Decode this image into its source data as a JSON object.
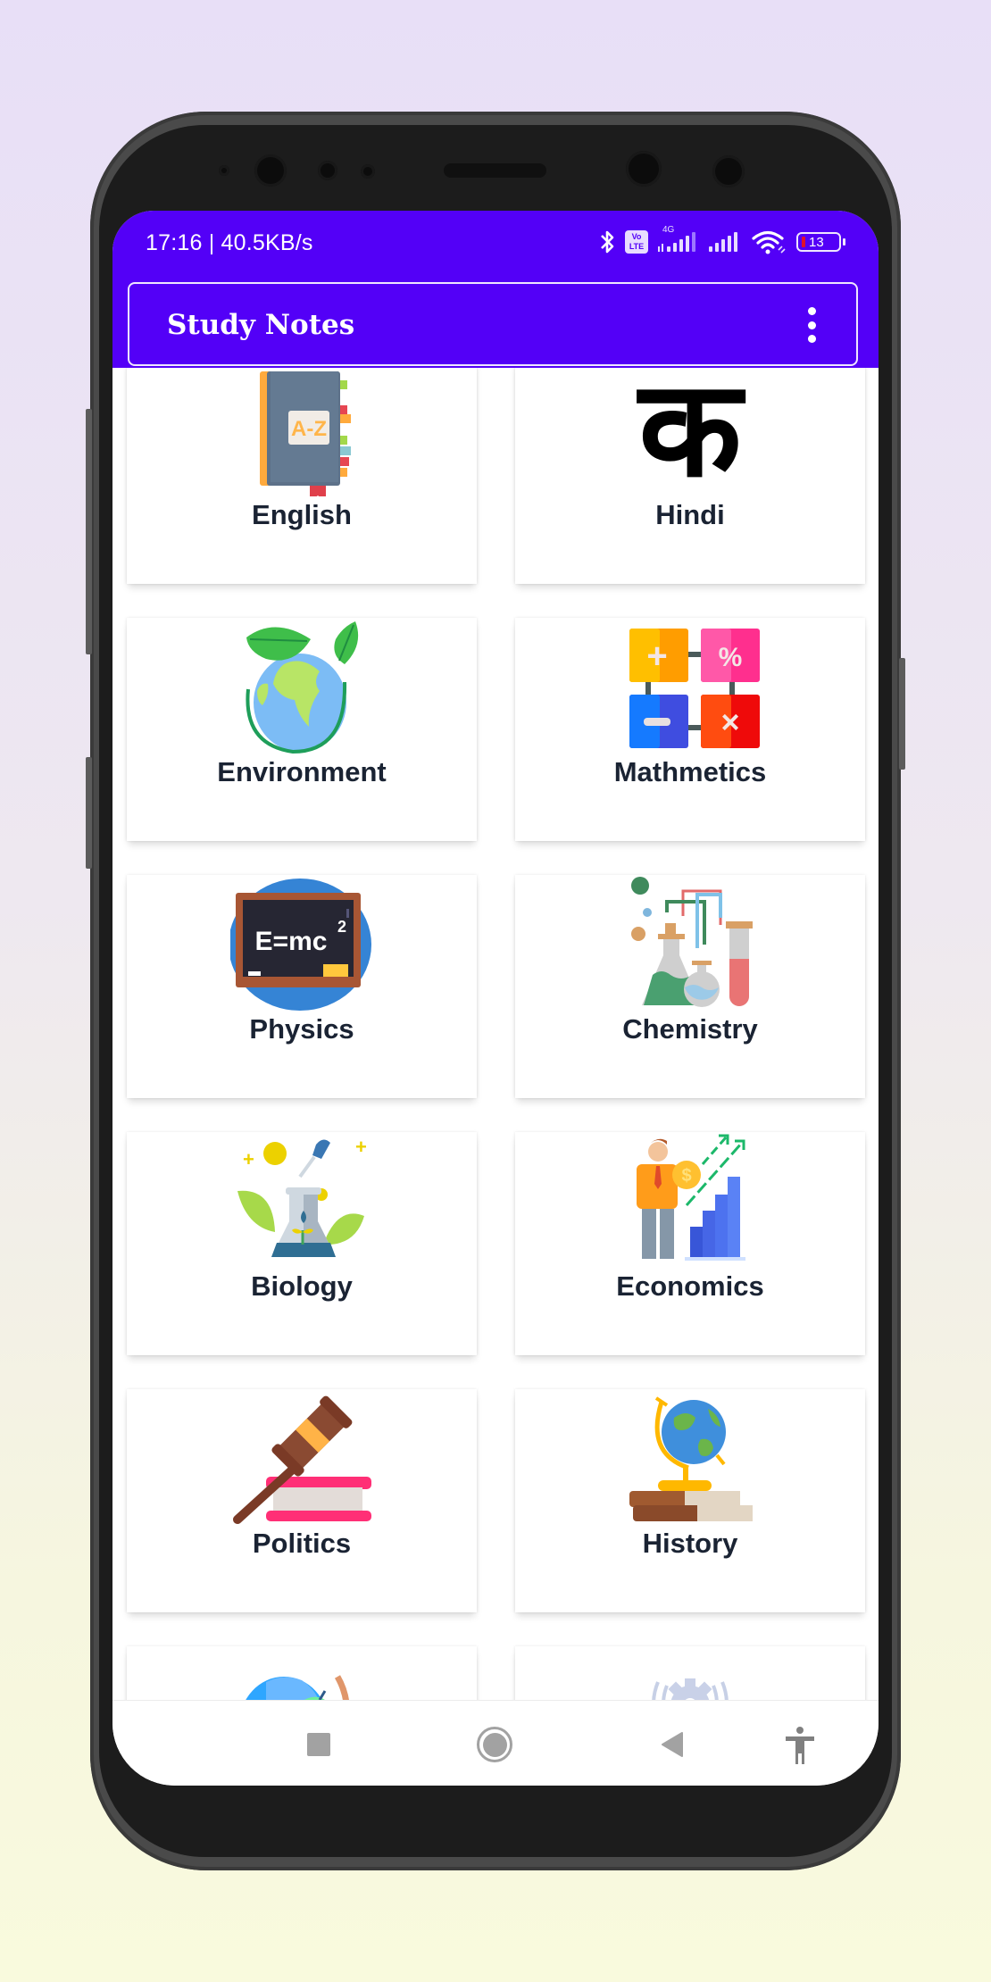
{
  "status_bar": {
    "time_speed": "17:16 | 40.5KB/s",
    "network_label": "4G",
    "volte_label_top": "Vo",
    "volte_label_bottom": "LTE",
    "battery_level": "13",
    "icons": [
      "bluetooth-icon",
      "volte-icon",
      "signal-4g-icon",
      "signal-icon",
      "wifi-icon",
      "battery-icon"
    ]
  },
  "app_bar": {
    "title": "Study Notes",
    "menu_icon": "overflow-menu-icon"
  },
  "subjects": [
    {
      "label": "English",
      "icon": "dictionary-book-icon"
    },
    {
      "label": "Hindi",
      "icon": "devanagari-ka-icon",
      "glyph": "क"
    },
    {
      "label": "Environment",
      "icon": "earth-leaves-icon"
    },
    {
      "label": "Mathmetics",
      "icon": "math-operators-icon"
    },
    {
      "label": "Physics",
      "icon": "blackboard-emc2-icon",
      "board_text": "E=mc",
      "board_sup": "2"
    },
    {
      "label": "Chemistry",
      "icon": "lab-flasks-icon"
    },
    {
      "label": "Biology",
      "icon": "flask-plant-icon"
    },
    {
      "label": "Economics",
      "icon": "growth-chart-person-icon",
      "coin_symbol": "$"
    },
    {
      "label": "Politics",
      "icon": "gavel-book-icon"
    },
    {
      "label": "History",
      "icon": "globe-books-icon"
    },
    {
      "label": "",
      "icon": "geography-globe-icon"
    },
    {
      "label": "",
      "icon": "gear-vibration-icon"
    }
  ],
  "nav_bar": {
    "buttons": [
      "recents-button",
      "home-button",
      "back-button",
      "accessibility-button"
    ]
  },
  "colors": {
    "primary": "#5300f7",
    "label_text": "#1a2333"
  }
}
